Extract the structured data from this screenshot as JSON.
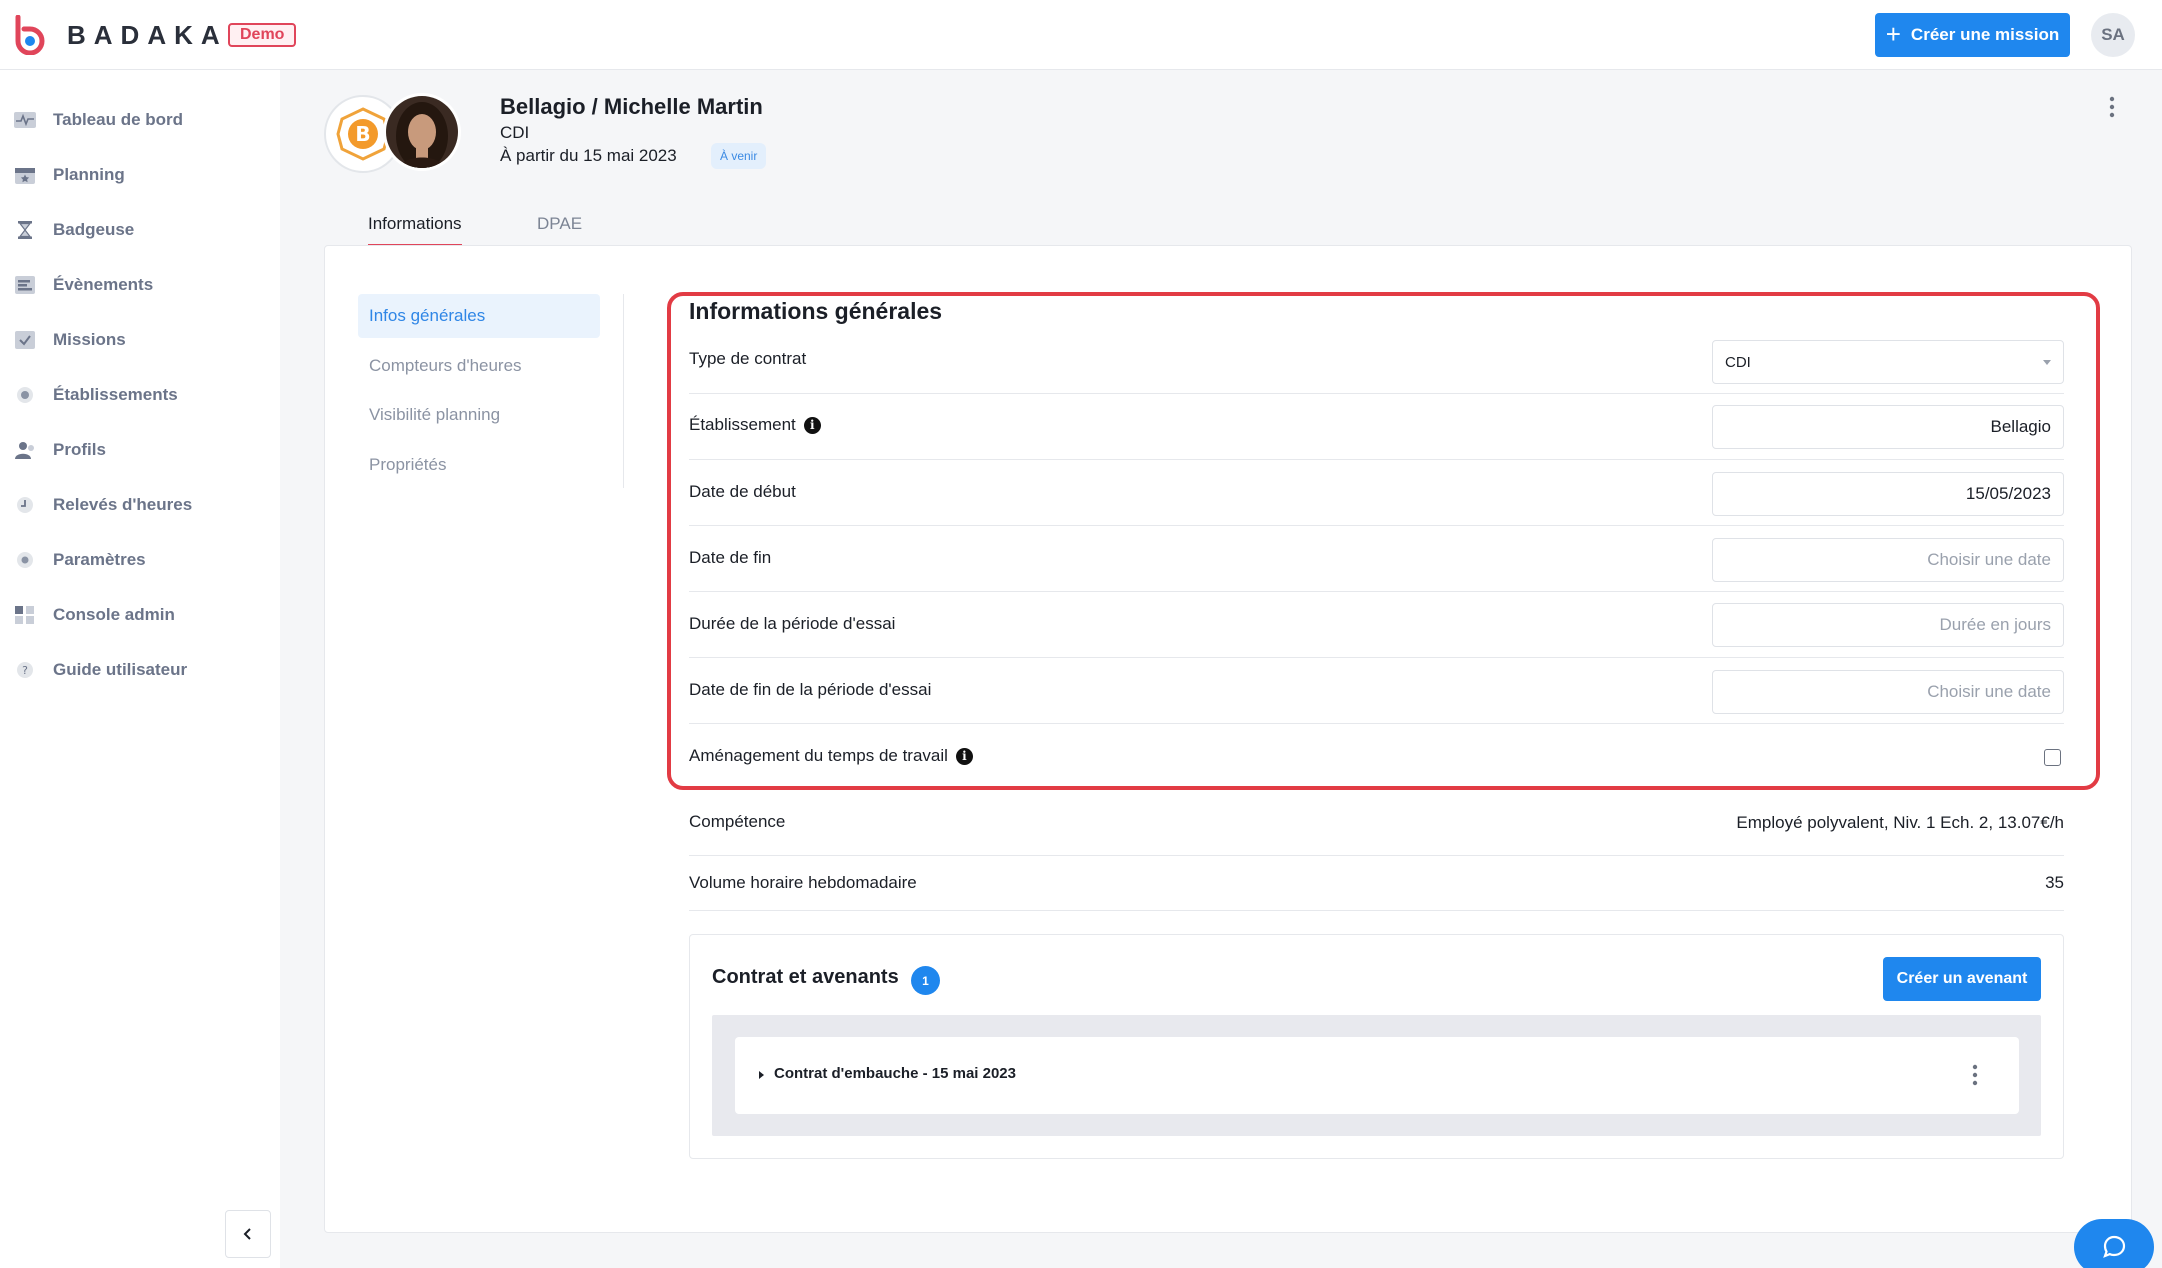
{
  "app": {
    "brand": "BADAKAN",
    "env_badge": "Demo",
    "create_mission_label": "Créer une mission",
    "user_initials": "SA",
    "accent_color": "#1f87ee",
    "alert_color": "#e0455a"
  },
  "sidebar": {
    "items": [
      {
        "label": "Tableau de bord",
        "icon": "activity-icon"
      },
      {
        "label": "Planning",
        "icon": "calendar-icon"
      },
      {
        "label": "Badgeuse",
        "icon": "hourglass-icon"
      },
      {
        "label": "Évènements",
        "icon": "events-icon"
      },
      {
        "label": "Missions",
        "icon": "checklist-icon"
      },
      {
        "label": "Établissements",
        "icon": "location-icon"
      },
      {
        "label": "Profils",
        "icon": "user-icon"
      },
      {
        "label": "Relevés d'heures",
        "icon": "clock-icon"
      },
      {
        "label": "Paramètres",
        "icon": "gear-icon"
      },
      {
        "label": "Console admin",
        "icon": "grid-icon"
      },
      {
        "label": "Guide utilisateur",
        "icon": "help-icon"
      }
    ]
  },
  "employee": {
    "title": "Bellagio / Michelle Martin",
    "contract_type": "CDI",
    "start_text": "À partir du 15 mai 2023",
    "status": "À venir"
  },
  "tabs": [
    {
      "label": "Informations",
      "active": true
    },
    {
      "label": "DPAE",
      "active": false
    }
  ],
  "subnav": [
    {
      "label": "Infos générales",
      "active": true
    },
    {
      "label": "Compteurs d'heures",
      "active": false
    },
    {
      "label": "Visibilité planning",
      "active": false
    },
    {
      "label": "Propriétés",
      "active": false
    }
  ],
  "form": {
    "title": "Informations générales",
    "contract_type": {
      "label": "Type de contrat",
      "value": "CDI"
    },
    "establishment": {
      "label": "Établissement",
      "value": "Bellagio"
    },
    "start_date": {
      "label": "Date de début",
      "value": "15/05/2023"
    },
    "end_date": {
      "label": "Date de fin",
      "placeholder": "Choisir une date"
    },
    "trial_duration": {
      "label": "Durée de la période d'essai",
      "placeholder": "Durée en jours"
    },
    "trial_end": {
      "label": "Date de fin de la période d'essai",
      "placeholder": "Choisir une date"
    },
    "work_time_arrangement": {
      "label": "Aménagement du temps de travail",
      "checked": false
    },
    "info_glyph": "i"
  },
  "details": {
    "skill": {
      "label": "Compétence",
      "value": "Employé polyvalent, Niv. 1 Ech. 2, 13.07€/h"
    },
    "weekly_hours": {
      "label": "Volume horaire hebdomadaire",
      "value": "35"
    }
  },
  "contracts": {
    "title": "Contrat et avenants",
    "count": "1",
    "create_label": "Créer un avenant",
    "items": [
      {
        "label": "Contrat d'embauche - 15 mai 2023"
      }
    ]
  }
}
